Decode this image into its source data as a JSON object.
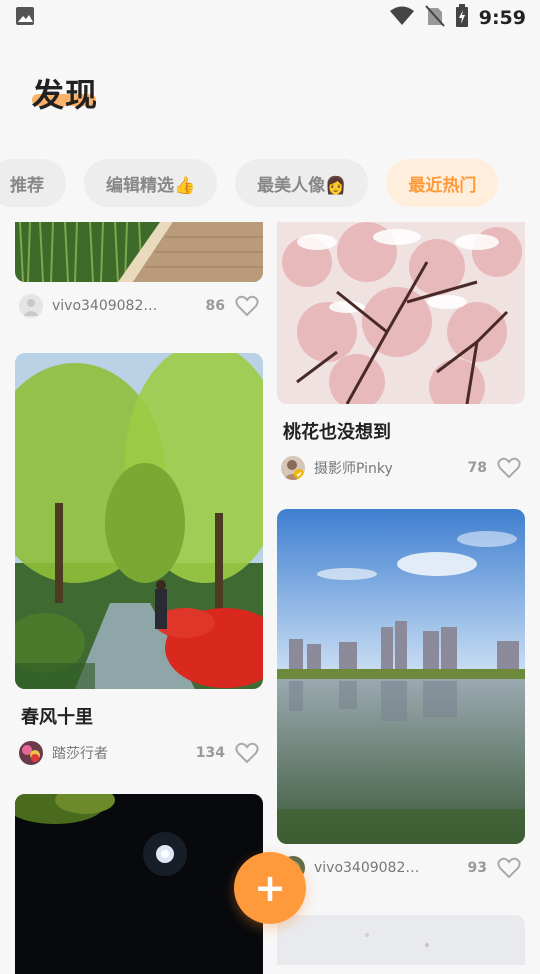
{
  "status_bar": {
    "time": "9:59"
  },
  "header": {
    "title": "发现"
  },
  "tabs": [
    {
      "label": "推荐",
      "active": false
    },
    {
      "label": "编辑精选👍",
      "active": false
    },
    {
      "label": "最美人像👩",
      "active": false
    },
    {
      "label": "最近热门",
      "active": true
    }
  ],
  "cards": {
    "left_top": {
      "author": "vivo34090828...",
      "likes": "86"
    },
    "left_mid": {
      "title": "春风十里",
      "author": "踏莎行者",
      "likes": "134"
    },
    "right_top": {
      "title": "桃花也没想到",
      "author": "摄影师Pinky",
      "likes": "78"
    },
    "right_mid": {
      "author": "vivo34090828...",
      "likes": "93"
    }
  },
  "fab": {
    "label": "+"
  },
  "colors": {
    "accent": "#ff9a3c",
    "active_tab_bg": "#ffeedc"
  }
}
